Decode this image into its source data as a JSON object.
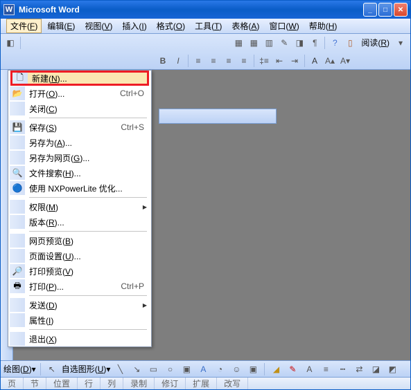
{
  "titlebar": {
    "title": "Microsoft Word"
  },
  "menubar": {
    "items": [
      {
        "label": "文件",
        "mnemonic": "F"
      },
      {
        "label": "编辑",
        "mnemonic": "E"
      },
      {
        "label": "视图",
        "mnemonic": "V"
      },
      {
        "label": "插入",
        "mnemonic": "I"
      },
      {
        "label": "格式",
        "mnemonic": "O"
      },
      {
        "label": "工具",
        "mnemonic": "T"
      },
      {
        "label": "表格",
        "mnemonic": "A"
      },
      {
        "label": "窗口",
        "mnemonic": "W"
      },
      {
        "label": "帮助",
        "mnemonic": "H"
      }
    ]
  },
  "toolbar": {
    "read_label": "阅读",
    "read_mnemonic": "R"
  },
  "file_menu": {
    "items": [
      {
        "label": "新建",
        "mnemonic": "N",
        "trail": "...",
        "shortcut": "",
        "icon": "new-doc",
        "highlight": true,
        "submenu": false
      },
      {
        "label": "打开",
        "mnemonic": "O",
        "trail": "...",
        "shortcut": "Ctrl+O",
        "icon": "open",
        "submenu": false
      },
      {
        "label": "关闭",
        "mnemonic": "C",
        "trail": "",
        "shortcut": "",
        "icon": "",
        "submenu": false
      },
      {
        "sep": true
      },
      {
        "label": "保存",
        "mnemonic": "S",
        "trail": "",
        "shortcut": "Ctrl+S",
        "icon": "save",
        "submenu": false
      },
      {
        "label": "另存为",
        "mnemonic": "A",
        "trail": "...",
        "shortcut": "",
        "icon": "",
        "submenu": false
      },
      {
        "label": "另存为网页",
        "mnemonic": "G",
        "trail": "...",
        "shortcut": "",
        "icon": "",
        "submenu": false
      },
      {
        "label": "文件搜索",
        "mnemonic": "H",
        "trail": "...",
        "shortcut": "",
        "icon": "search",
        "submenu": false
      },
      {
        "label": "使用 NXPowerLite 优化...",
        "mnemonic": "",
        "trail": "",
        "shortcut": "",
        "icon": "optimize",
        "submenu": false
      },
      {
        "sep": true
      },
      {
        "label": "权限",
        "mnemonic": "M",
        "trail": "",
        "shortcut": "",
        "icon": "",
        "submenu": true
      },
      {
        "label": "版本",
        "mnemonic": "R",
        "trail": "...",
        "shortcut": "",
        "icon": "",
        "submenu": false
      },
      {
        "sep": true
      },
      {
        "label": "网页预览",
        "mnemonic": "B",
        "trail": "",
        "shortcut": "",
        "icon": "",
        "submenu": false
      },
      {
        "label": "页面设置",
        "mnemonic": "U",
        "trail": "...",
        "shortcut": "",
        "icon": "",
        "submenu": false
      },
      {
        "label": "打印预览",
        "mnemonic": "V",
        "trail": "",
        "shortcut": "",
        "icon": "print-preview",
        "submenu": false
      },
      {
        "label": "打印",
        "mnemonic": "P",
        "trail": "...",
        "shortcut": "Ctrl+P",
        "icon": "print",
        "submenu": false
      },
      {
        "sep": true
      },
      {
        "label": "发送",
        "mnemonic": "D",
        "trail": "",
        "shortcut": "",
        "icon": "",
        "submenu": true
      },
      {
        "label": "属性",
        "mnemonic": "I",
        "trail": "",
        "shortcut": "",
        "icon": "",
        "submenu": false
      },
      {
        "sep": true
      },
      {
        "label": "退出",
        "mnemonic": "X",
        "trail": "",
        "shortcut": "",
        "icon": "",
        "submenu": false
      }
    ]
  },
  "bottom_toolbar": {
    "draw_label": "绘图",
    "draw_mnemonic": "D",
    "autoshape_label": "自选图形",
    "autoshape_mnemonic": "U"
  },
  "statusbar": {
    "cells": [
      "页",
      "节",
      "位置",
      "行",
      "列",
      "录制",
      "修订",
      "扩展",
      "改写"
    ]
  }
}
